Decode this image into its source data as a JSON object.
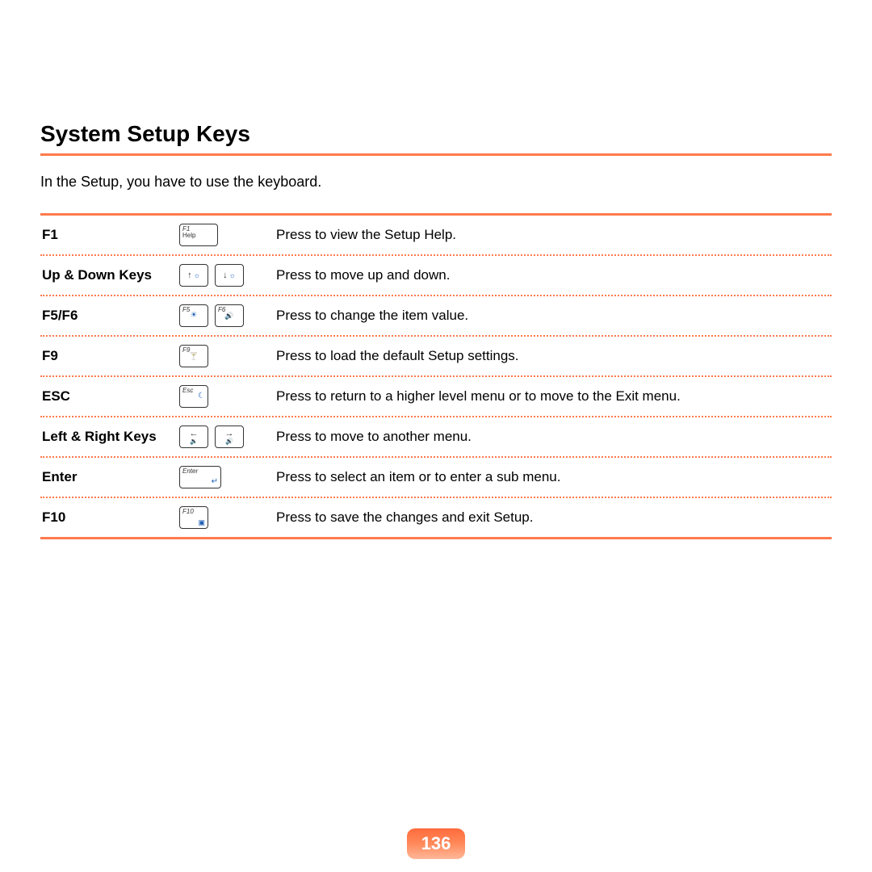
{
  "title": "System Setup Keys",
  "intro": "In the Setup, you have to use the keyboard.",
  "page_number": "136",
  "rows": [
    {
      "key": "F1",
      "cap1_top": "F1",
      "cap1_bot": "Help",
      "desc": "Press to view the Setup Help."
    },
    {
      "key": "Up & Down Keys",
      "desc": "Press to move up and down."
    },
    {
      "key": "F5/F6",
      "cap1_top": "F5",
      "cap2_top": "F6",
      "desc": "Press to change the item value."
    },
    {
      "key": "F9",
      "cap1_top": "F9",
      "desc": "Press to load the default Setup settings."
    },
    {
      "key": "ESC",
      "cap1_top": "Esc",
      "desc": "Press to return to a higher level menu or to move to the Exit menu."
    },
    {
      "key": "Left & Right Keys",
      "desc": "Press to move to another menu."
    },
    {
      "key": "Enter",
      "cap1_top": "Enter",
      "desc": "Press to select an item or to enter a sub menu."
    },
    {
      "key": "F10",
      "cap1_top": "F10",
      "desc": "Press to save the changes and exit Setup."
    }
  ]
}
